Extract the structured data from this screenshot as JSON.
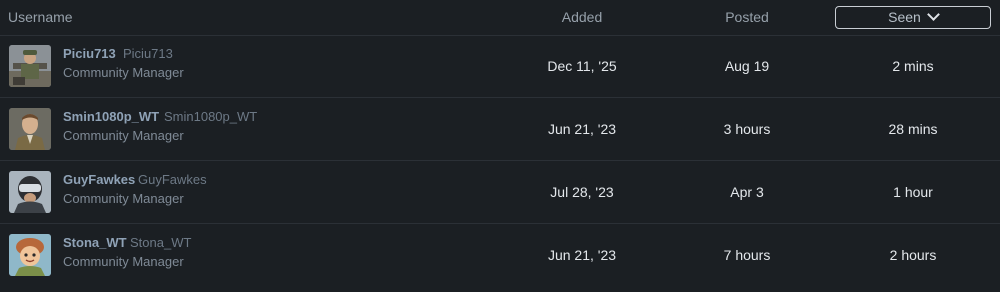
{
  "header": {
    "username_label": "Username",
    "added_label": "Added",
    "posted_label": "Posted",
    "seen_label": "Seen",
    "sort_icon": "chevron-down-icon"
  },
  "rows": [
    {
      "username": "Piciu713",
      "alt_name": "Piciu713",
      "title": "Community Manager",
      "added": "Dec 11, '25",
      "posted": "Aug 19",
      "seen": "2 mins",
      "avatar": "soldier-with-cannon-avatar"
    },
    {
      "username": "Smin1080p_WT",
      "alt_name": "Smin1080p_WT",
      "title": "Community Manager",
      "added": "Jun 21, '23",
      "posted": "3 hours",
      "seen": "28 mins",
      "avatar": "officer-portrait-avatar"
    },
    {
      "username": "GuyFawkes",
      "alt_name": "GuyFawkes",
      "title": "Community Manager",
      "added": "Jul 28, '23",
      "posted": "Apr 3",
      "seen": "1 hour",
      "avatar": "pilot-helmet-avatar"
    },
    {
      "username": "Stona_WT",
      "alt_name": "Stona_WT",
      "title": "Community Manager",
      "added": "Jun 21, '23",
      "posted": "7 hours",
      "seen": "2 hours",
      "avatar": "cartoon-character-avatar"
    }
  ]
}
